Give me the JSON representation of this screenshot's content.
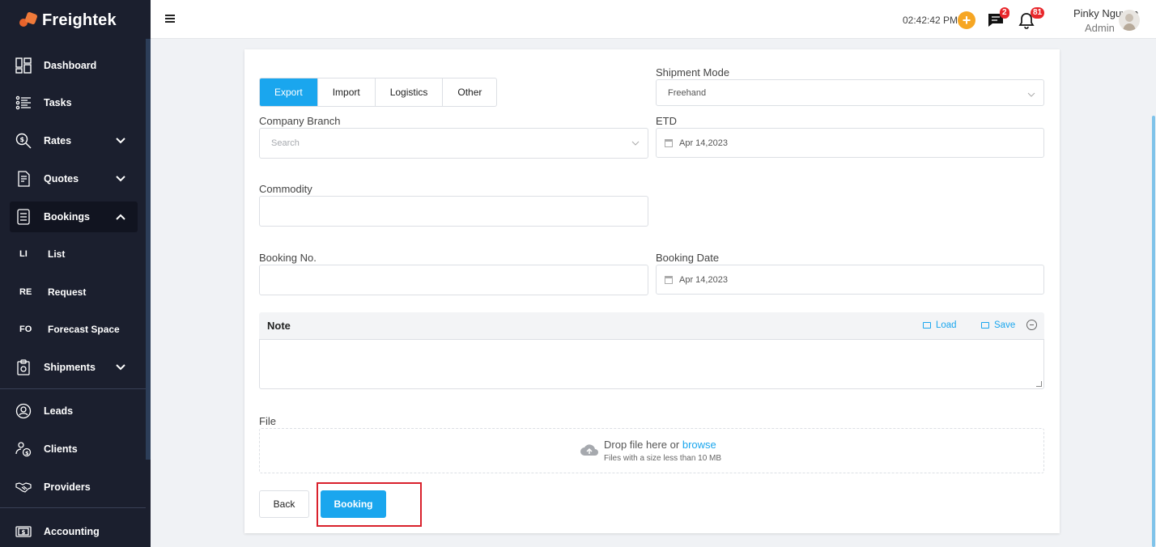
{
  "app": {
    "name": "Freightek"
  },
  "sidebar": {
    "items": [
      {
        "label": "Dashboard",
        "icon": "dashboard-icon"
      },
      {
        "label": "Tasks",
        "icon": "tasks-icon"
      },
      {
        "label": "Rates",
        "icon": "rates-icon"
      },
      {
        "label": "Quotes",
        "icon": "quotes-icon"
      },
      {
        "label": "Bookings",
        "icon": "bookings-icon"
      },
      {
        "label": "Shipments",
        "icon": "shipments-icon"
      },
      {
        "label": "Leads",
        "icon": "leads-icon"
      },
      {
        "label": "Clients",
        "icon": "clients-icon"
      },
      {
        "label": "Providers",
        "icon": "providers-icon"
      },
      {
        "label": "Accounting",
        "icon": "accounting-icon"
      }
    ],
    "sub_items": [
      {
        "abbr": "LI",
        "label": "List"
      },
      {
        "abbr": "RE",
        "label": "Request"
      },
      {
        "abbr": "FO",
        "label": "Forecast Space"
      }
    ]
  },
  "topbar": {
    "time": "02:42:42 PM",
    "plus": "+",
    "chat_badge": "2",
    "notification_badge": "81",
    "user_name": "Pinky Nguyen",
    "user_role": "Admin"
  },
  "form": {
    "tabs": [
      "Export",
      "Import",
      "Logistics",
      "Other"
    ],
    "shipment_mode": {
      "label": "Shipment Mode",
      "value": "Freehand"
    },
    "company_branch": {
      "label": "Company Branch",
      "placeholder": "Search"
    },
    "etd": {
      "label": "ETD",
      "value": "Apr 14,2023"
    },
    "commodity": {
      "label": "Commodity"
    },
    "booking_no": {
      "label": "Booking No."
    },
    "booking_date": {
      "label": "Booking Date",
      "value": "Apr 14,2023"
    },
    "note": {
      "title": "Note",
      "load": "Load",
      "save": "Save"
    },
    "file": {
      "label": "File",
      "drop_text": "Drop file here or",
      "browse": "browse",
      "hint": "Files with a size less than 10 MB"
    },
    "back_label": "Back",
    "booking_label": "Booking"
  },
  "colors": {
    "accent": "#1aa6ee",
    "sidebar": "#1b1f2e",
    "highlight": "#d9212c",
    "badge": "#e8272b"
  }
}
